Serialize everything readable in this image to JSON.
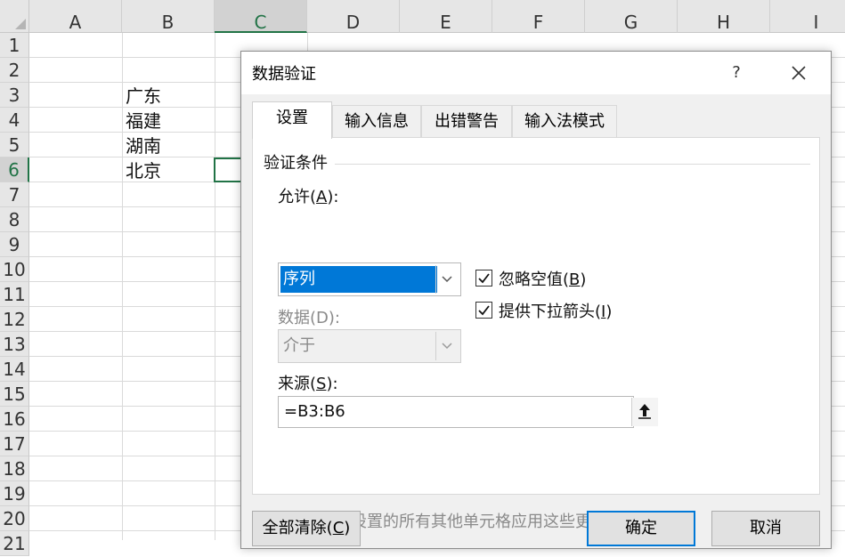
{
  "sheet": {
    "columns": [
      "A",
      "B",
      "C",
      "D",
      "E",
      "F",
      "G",
      "H",
      "I"
    ],
    "rows": [
      "1",
      "2",
      "3",
      "4",
      "5",
      "6",
      "7",
      "8",
      "9",
      "10",
      "11",
      "12",
      "13",
      "14",
      "15",
      "16",
      "17",
      "18",
      "19",
      "20",
      "21"
    ],
    "active_column": "C",
    "active_row": "6",
    "cells": [
      {
        "ref": "B3",
        "value": "广东"
      },
      {
        "ref": "B4",
        "value": "福建"
      },
      {
        "ref": "B5",
        "value": "湖南"
      },
      {
        "ref": "B6",
        "value": "北京"
      }
    ]
  },
  "dialog": {
    "title": "数据验证",
    "help_label": "?",
    "tabs": [
      {
        "label": "设置",
        "active": true
      },
      {
        "label": "输入信息",
        "active": false
      },
      {
        "label": "出错警告",
        "active": false
      },
      {
        "label": "输入法模式",
        "active": false
      }
    ],
    "group_label": "验证条件",
    "allow": {
      "label_pre": "允许(",
      "label_key": "A",
      "label_post": "):",
      "value": "序列"
    },
    "data": {
      "label_pre": "数据(",
      "label_key": "D",
      "label_post": "):",
      "value": "介于"
    },
    "ignore_blank": {
      "label_pre": "忽略空值(",
      "label_key": "B",
      "label_post": ")",
      "checked": true
    },
    "in_cell_dropdown": {
      "label_pre": "提供下拉箭头(",
      "label_key": "I",
      "label_post": ")",
      "checked": true
    },
    "source": {
      "label_pre": "来源(",
      "label_key": "S",
      "label_post": "):",
      "value": "=B3:B6"
    },
    "apply_all": {
      "label": "对有同样设置的所有其他单元格应用这些更改(P)",
      "checked": false
    },
    "buttons": {
      "clear_all_pre": "全部清除(",
      "clear_all_key": "C",
      "clear_all_post": ")",
      "ok": "确定",
      "cancel": "取消"
    }
  },
  "colors": {
    "accent": "#217346",
    "selection": "#0078d7"
  }
}
